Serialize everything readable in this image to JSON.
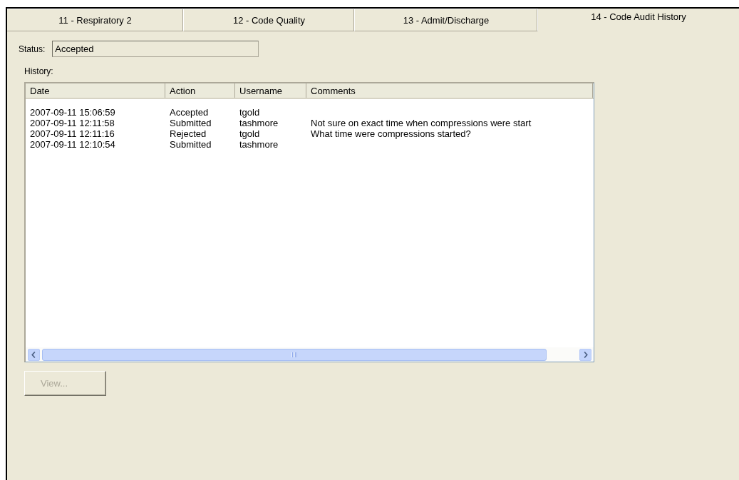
{
  "tabs": [
    {
      "label": "11 - Respiratory 2",
      "selected": false
    },
    {
      "label": "12 - Code Quality",
      "selected": false
    },
    {
      "label": "13 - Admit/Discharge",
      "selected": false
    },
    {
      "label": "14 - Code Audit History",
      "selected": true
    }
  ],
  "status": {
    "label": "Status:",
    "value": "Accepted"
  },
  "history": {
    "label": "History:",
    "columns": [
      "Date",
      "Action",
      "Username",
      "Comments"
    ],
    "rows": [
      {
        "date": "2007-09-11 15:06:59",
        "action": "Accepted",
        "username": "tgold"
      },
      {
        "date": "2007-09-11 12:11:58",
        "action": "Submitted",
        "username": "tashmore",
        "comments": "Not sure on exact time when compressions were start"
      },
      {
        "date": "2007-09-11 12:11:16",
        "action": "Rejected",
        "username": "tgold",
        "comments": "What time were compressions started?"
      },
      {
        "date": "2007-09-11 12:10:54",
        "action": "Submitted",
        "username": "tashmore"
      }
    ]
  },
  "view_button": {
    "label": "View...",
    "disabled": true
  }
}
